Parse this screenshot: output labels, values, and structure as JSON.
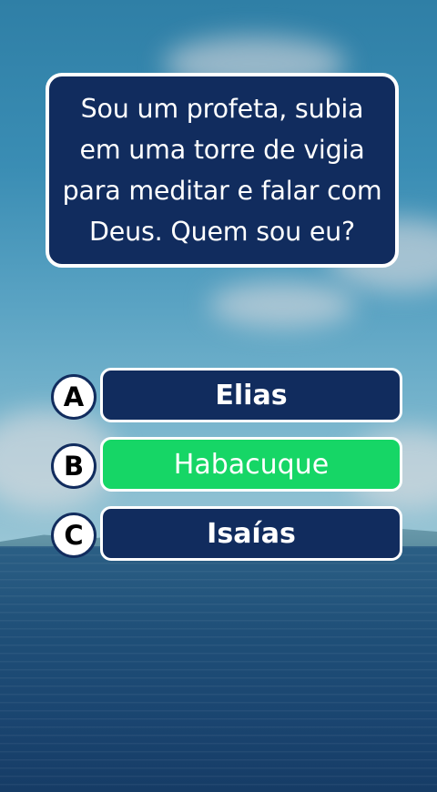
{
  "question": {
    "lines": [
      "Sou um profeta, subia",
      "em uma torre de vigia",
      "para meditar e falar com",
      "Deus. Quem sou eu?"
    ]
  },
  "options": [
    {
      "letter": "A",
      "label": "Elias",
      "state": "default"
    },
    {
      "letter": "B",
      "label": "Habacuque",
      "state": "correct"
    },
    {
      "letter": "C",
      "label": "Isaías",
      "state": "default"
    }
  ],
  "colors": {
    "panel": "#112c5e",
    "correct": "#16d666",
    "border": "#ffffff"
  }
}
